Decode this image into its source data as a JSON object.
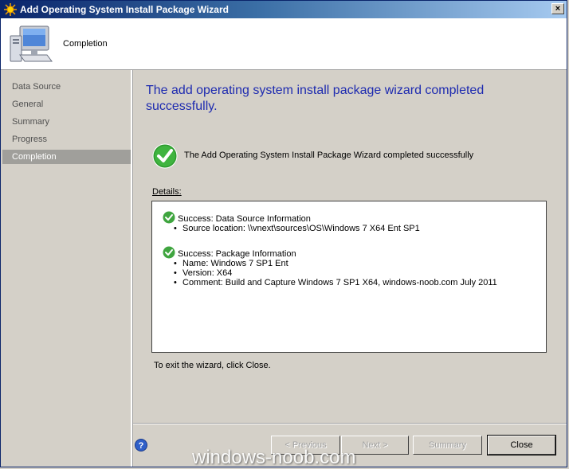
{
  "window": {
    "title": "Add Operating System Install Package Wizard",
    "close_glyph": "×"
  },
  "header": {
    "heading": "Completion"
  },
  "nav": {
    "items": [
      {
        "label": "Data Source"
      },
      {
        "label": "General"
      },
      {
        "label": "Summary"
      },
      {
        "label": "Progress"
      },
      {
        "label": "Completion",
        "active": true
      }
    ]
  },
  "content": {
    "title": "The add operating system install package wizard completed successfully.",
    "status_text": "The Add Operating System Install Package Wizard completed successfully",
    "details_label": "Details:",
    "details": [
      {
        "label": "Success: Data Source Information",
        "items": [
          "Source location: \\\\vnext\\sources\\OS\\Windows 7 X64 Ent SP1"
        ]
      },
      {
        "label": "Success: Package Information",
        "items": [
          "Name: Windows 7 SP1 Ent",
          "Version: X64",
          "Comment: Build and Capture Windows 7 SP1 X64, windows-noob.com July 2011"
        ]
      }
    ],
    "exit_text": "To exit the wizard, click Close."
  },
  "buttons": {
    "previous": "< Previous",
    "next": "Next >",
    "summary": "Summary",
    "close": "Close"
  },
  "watermark": "windows-noob.com",
  "colors": {
    "title_blue": "#1e2bb0",
    "success_green": "#2e9a2e",
    "nav_active": "#a09f9b"
  }
}
